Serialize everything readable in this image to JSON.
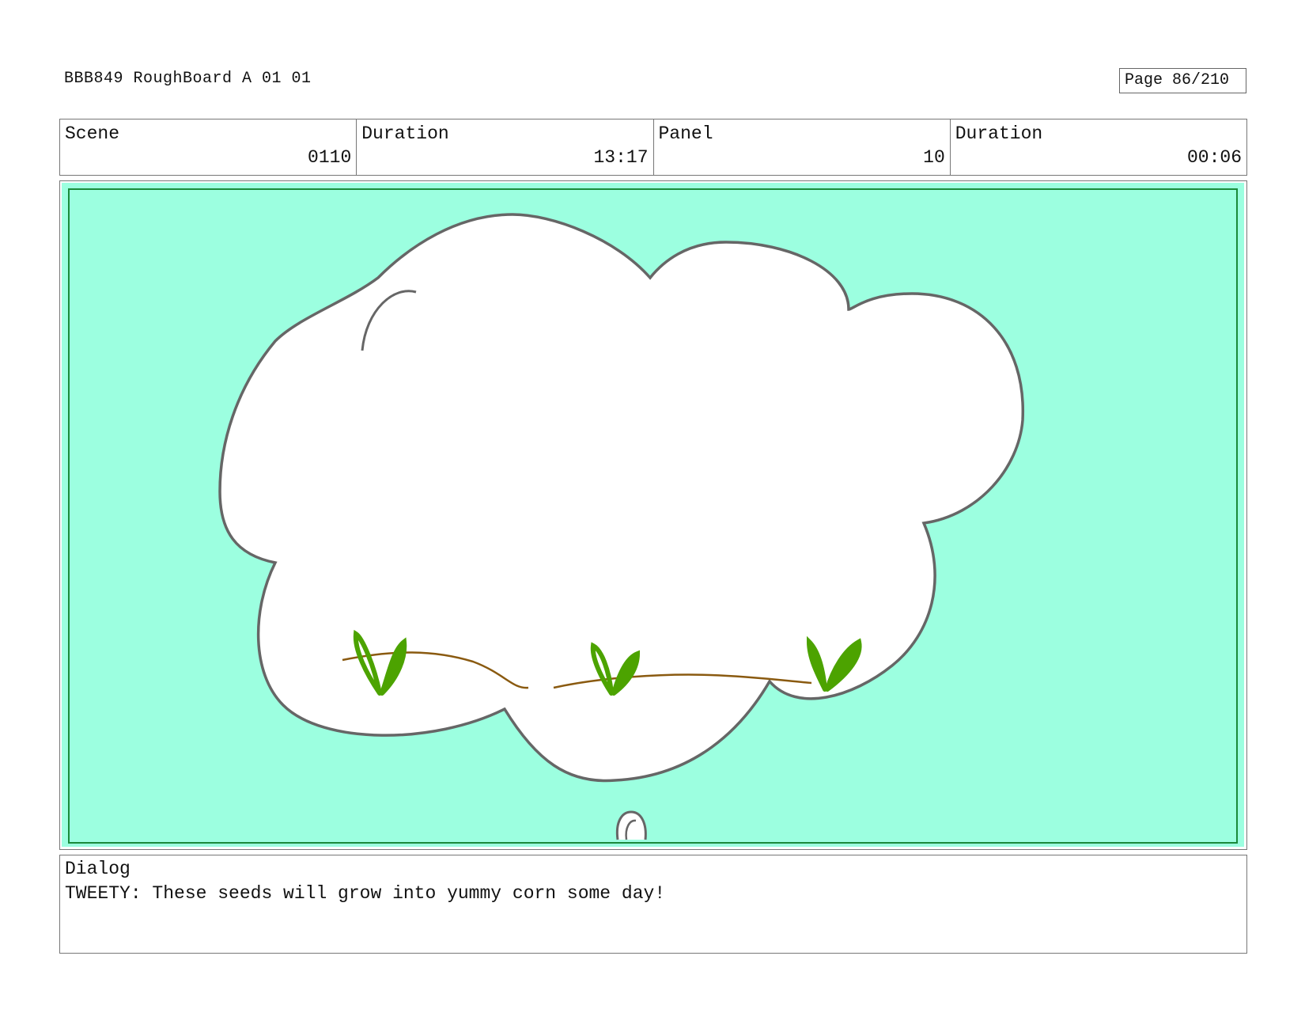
{
  "header": {
    "title": "BBB849 RoughBoard A 01 01",
    "page": "Page  86/210"
  },
  "info": {
    "scene_label": "Scene",
    "scene_value": "0110",
    "duration_label": "Duration",
    "duration_value": "13:17",
    "panel_label": "Panel",
    "panel_value": "10",
    "panel_duration_label": "Duration",
    "panel_duration_value": "00:06"
  },
  "panel": {
    "background_color": "#9cffe0",
    "frame_color": "#1a8a3a",
    "cloud_outline_color": "#666666",
    "sprout_color": "#4ca300",
    "soil_line_color": "#8a5a10"
  },
  "dialog": {
    "label": "Dialog",
    "text": "TWEETY: These seeds will grow into yummy corn some day!"
  }
}
